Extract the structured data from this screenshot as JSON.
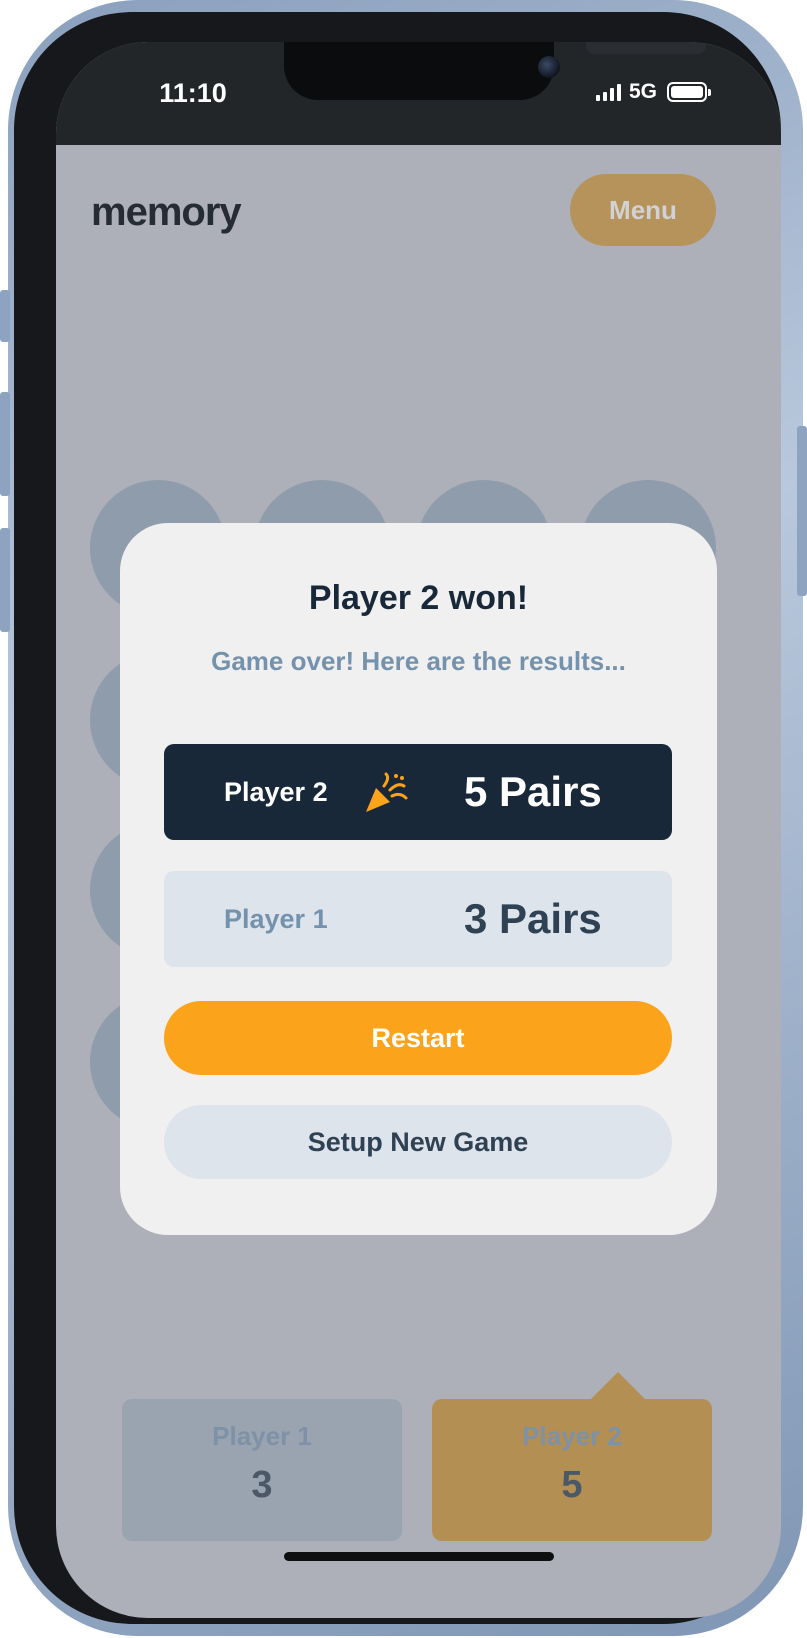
{
  "status_bar": {
    "time": "11:10",
    "network": "5G"
  },
  "header": {
    "logo": "memory",
    "menu_label": "Menu"
  },
  "scoreboard": [
    {
      "name": "Player 1",
      "score": "3"
    },
    {
      "name": "Player 2",
      "score": "5"
    }
  ],
  "modal": {
    "title": "Player 2 won!",
    "subtitle": "Game over! Here are the results...",
    "results": [
      {
        "name": "Player 2",
        "score": "5 Pairs",
        "winner": true,
        "icon": "party-popper-icon"
      },
      {
        "name": "Player 1",
        "score": "3 Pairs",
        "winner": false
      }
    ],
    "restart_label": "Restart",
    "setup_label": "Setup New Game"
  },
  "colors": {
    "dark_navy": "#182839",
    "orange": "#fba31a",
    "light_gray": "#dee4eb",
    "overlay_bg": "#adb0b8"
  }
}
